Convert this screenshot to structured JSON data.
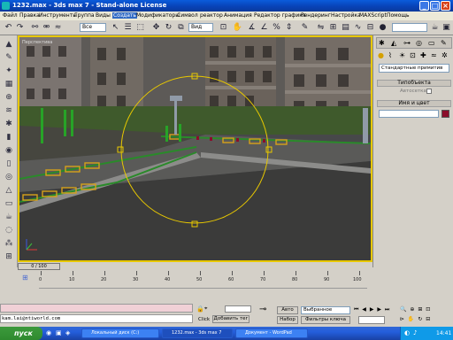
{
  "window": {
    "title": "1232.max - 3ds max 7 - Stand-alone License"
  },
  "menu": [
    "Файл",
    "Правка",
    "Инструменты",
    "Группа",
    "Виды",
    "Создать",
    "Модификаторы",
    "Символ",
    "реактор",
    "Анимация",
    "Редактор графика",
    "Рендеринг",
    "Настройка",
    "MAXScript",
    "Помощь"
  ],
  "toolbar": {
    "selection_filter": "Все",
    "view_combo": "Вид"
  },
  "viewport": {
    "label": "Перспектива"
  },
  "command_panel": {
    "category_select": "Стандартные примитив",
    "rollout_object_type": "Типобъекта",
    "autogrid_label": "Автосетка",
    "rollout_name_color": "Имя и цвет"
  },
  "timeline": {
    "frame_display": "0 / 100",
    "ticks": [
      "0",
      "10",
      "20",
      "30",
      "40",
      "50",
      "60",
      "70",
      "80",
      "90",
      "100"
    ]
  },
  "status": {
    "script_output": "kam.lai@ntiworld.com",
    "click_label": "Click",
    "add_time_tag": "Добавить тег",
    "auto_key": "Авто",
    "set_key": "Набор",
    "key_mode_select": "Выбранное",
    "key_filters": "Фильтры ключа"
  },
  "taskbar": {
    "start": "пуск",
    "tasks": [
      "Локальный диск (C:)",
      "1232.max - 3ds max 7",
      "Документ - WordPad"
    ],
    "clock": "14:41"
  },
  "colors": {
    "viewport_border": "#e8c800",
    "object_color": "#8b0d2a",
    "title_blue": "#0a5cdc"
  }
}
